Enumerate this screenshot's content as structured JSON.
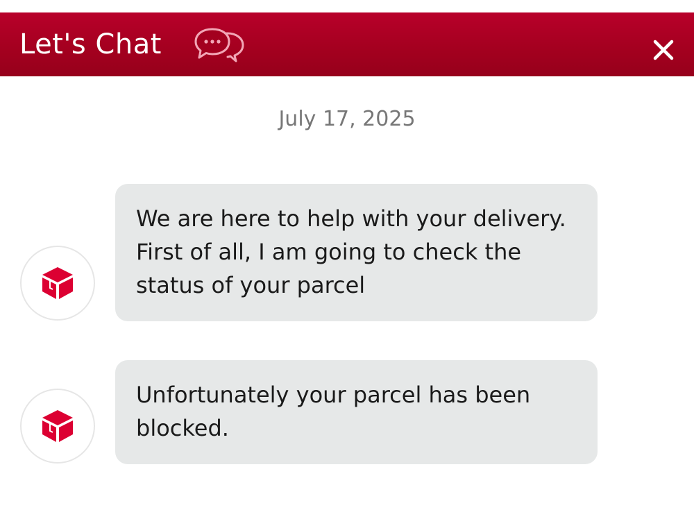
{
  "header": {
    "title": "Let's Chat",
    "chat_icon": "chat-bubbles-icon",
    "close_icon": "close-icon",
    "color": "#a3001f"
  },
  "conversation": {
    "date": "July 17, 2025",
    "messages": [
      {
        "sender_icon": "parcel-box-icon",
        "text": "We are here to help with your delivery. First of all, I am going to check the status of your parcel"
      },
      {
        "sender_icon": "parcel-box-icon",
        "text": "Unfortunately your parcel has been blocked."
      }
    ]
  },
  "colors": {
    "brand": "#dc0032",
    "bubble": "#e6e8e8",
    "date_text": "#777777"
  }
}
